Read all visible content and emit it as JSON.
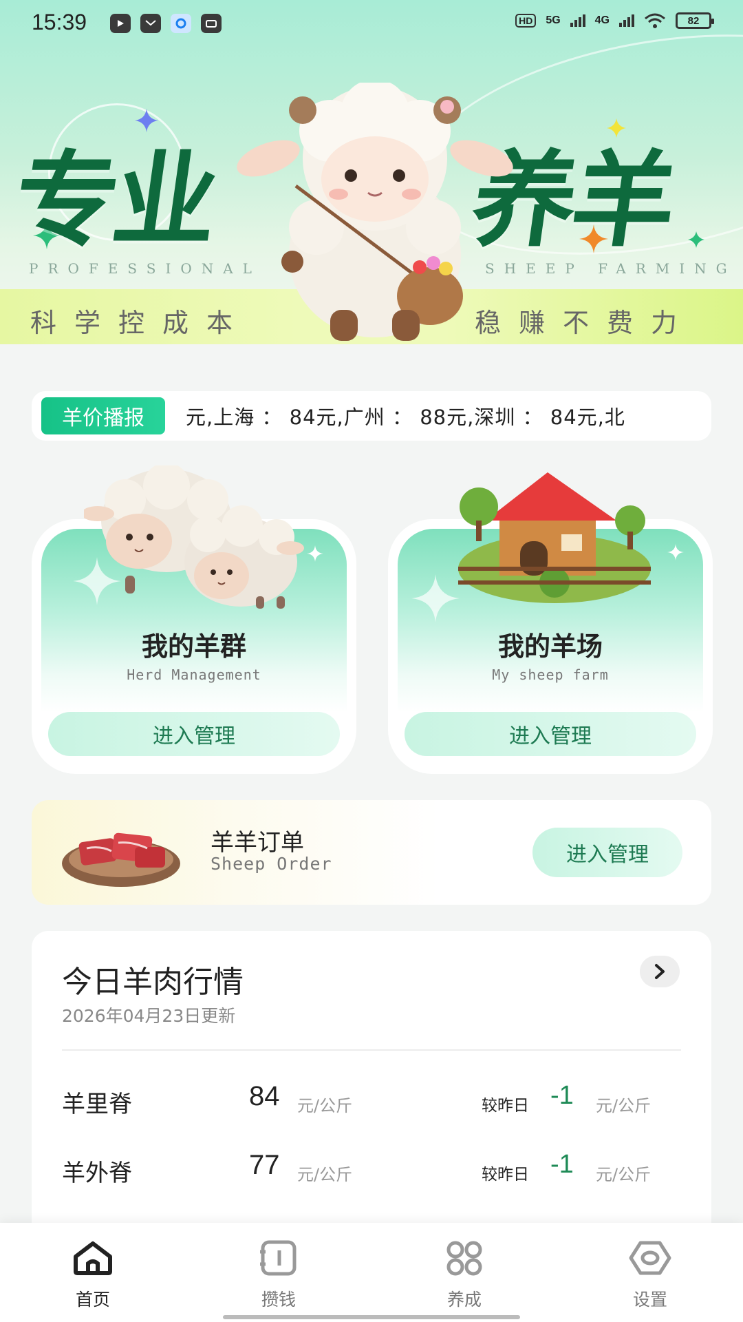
{
  "status_bar": {
    "time": "15:39",
    "battery": "82",
    "net1": "5G",
    "net2": "4G",
    "hd": "HD"
  },
  "hero": {
    "title_left": "专业",
    "title_right": "养羊",
    "en_left": "PROFESSIONAL",
    "en_right": "SHEEP FARMING",
    "slogan_left": "科学控成本",
    "slogan_right": "稳赚不费力",
    "accent_color": "#0e6a3d"
  },
  "ticker": {
    "tag": "羊价播报",
    "text": "元,上海 ： 84元,广州 ： 88元,深圳 ： 84元,北"
  },
  "cards": [
    {
      "title": "我的羊群",
      "subtitle": "Herd Management",
      "button": "进入管理"
    },
    {
      "title": "我的羊场",
      "subtitle": "My sheep farm",
      "button": "进入管理"
    }
  ],
  "order": {
    "title": "羊羊订单",
    "subtitle": "Sheep Order",
    "button": "进入管理"
  },
  "market": {
    "title": "今日羊肉行情",
    "updated": "2026年04月23日更新",
    "compare_label": "较昨日",
    "unit": "元/公斤",
    "rows": [
      {
        "name": "羊里脊",
        "price": "84",
        "delta": "-1"
      },
      {
        "name": "羊外脊",
        "price": "77",
        "delta": "-1"
      }
    ]
  },
  "tabs": [
    {
      "label": "首页",
      "icon": "home-icon",
      "active": true
    },
    {
      "label": "攒钱",
      "icon": "wallet-icon",
      "active": false
    },
    {
      "label": "养成",
      "icon": "grid-icon",
      "active": false
    },
    {
      "label": "设置",
      "icon": "settings-icon",
      "active": false
    }
  ],
  "colors": {
    "primary_green": "#16c287",
    "button_text": "#1d7a52",
    "delta_green": "#1e8a56"
  }
}
